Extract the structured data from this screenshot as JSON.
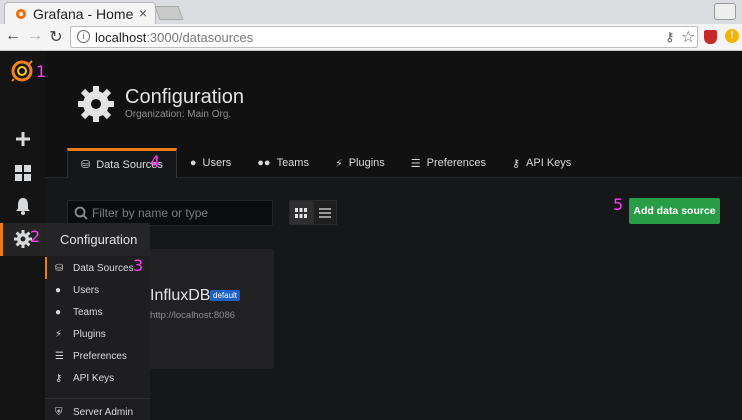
{
  "browser": {
    "tab_title": "Grafana - Home",
    "close_glyph": "×",
    "url_host": "localhost",
    "url_path": ":3000/datasources"
  },
  "header": {
    "title": "Configuration",
    "subtitle": "Organization: Main Org."
  },
  "tabs": [
    {
      "label": "Data Sources",
      "icon": "database-icon",
      "glyph": "⛁"
    },
    {
      "label": "Users",
      "icon": "user-icon",
      "glyph": "👤"
    },
    {
      "label": "Teams",
      "icon": "team-icon",
      "glyph": "👥"
    },
    {
      "label": "Plugins",
      "icon": "plugin-icon",
      "glyph": "⚡"
    },
    {
      "label": "Preferences",
      "icon": "sliders-icon",
      "glyph": "☰"
    },
    {
      "label": "API Keys",
      "icon": "key-icon",
      "glyph": "🔧"
    }
  ],
  "search": {
    "placeholder": "Filter by name or type"
  },
  "add_button": "Add data source",
  "datasource": {
    "name": "InfluxDB",
    "badge": "default",
    "url": "http://localhost:8086"
  },
  "flyout": {
    "title": "Configuration",
    "items": [
      {
        "label": "Data Sources",
        "glyph": "⛁"
      },
      {
        "label": "Users",
        "glyph": "●"
      },
      {
        "label": "Teams",
        "glyph": "●"
      },
      {
        "label": "Plugins",
        "glyph": "⚡"
      },
      {
        "label": "Preferences",
        "glyph": "☰"
      },
      {
        "label": "API Keys",
        "glyph": "⚷"
      },
      {
        "label": "Server Admin",
        "glyph": "⛨"
      }
    ]
  },
  "annotations": [
    "1",
    "2",
    "3",
    "4",
    "5"
  ],
  "colors": {
    "accent": "#eb7b18",
    "primary_button": "#299c46",
    "badge": "#1f60c4",
    "annotation": "#ff3df5"
  }
}
